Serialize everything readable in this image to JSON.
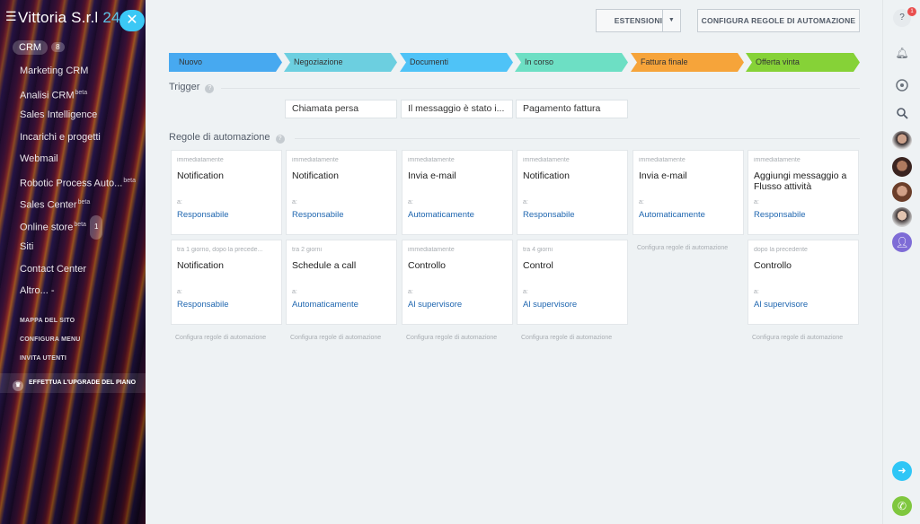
{
  "sidebar": {
    "company": "Vittoria S.r.l",
    "company_suffix": "24",
    "crm_label": "CRM",
    "crm_count": "8",
    "items": [
      {
        "label": "Marketing CRM",
        "beta": "",
        "count": ""
      },
      {
        "label": "Analisi CRM",
        "beta": "beta",
        "count": ""
      },
      {
        "label": "Sales Intelligence",
        "beta": "",
        "count": ""
      },
      {
        "label": "Incarichi e progetti",
        "beta": "",
        "count": ""
      },
      {
        "label": "Webmail",
        "beta": "",
        "count": ""
      },
      {
        "label": "Robotic Process Auto...",
        "beta": "beta",
        "count": ""
      },
      {
        "label": "Sales Center",
        "beta": "beta",
        "count": ""
      },
      {
        "label": "Online store",
        "beta": "beta",
        "count": "1"
      },
      {
        "label": "Siti",
        "beta": "",
        "count": ""
      },
      {
        "label": "Contact Center",
        "beta": "",
        "count": ""
      },
      {
        "label": "Altro... ",
        "beta": "",
        "count": "-"
      }
    ],
    "links": [
      "MAPPA DEL SITO",
      "CONFIGURA MENU",
      "INVITA UTENTI"
    ],
    "upgrade": "EFFETTUA L'UPGRADE DEL PIANO"
  },
  "toolbar": {
    "extensions_label": "ESTENSIONI",
    "config_label": "CONFIGURA REGOLE DI AUTOMAZIONE"
  },
  "stages": [
    {
      "label": "Nuovo",
      "color": "#47a9f0"
    },
    {
      "label": "Negoziazione",
      "color": "#6ccfe0"
    },
    {
      "label": "Documenti",
      "color": "#4fc3f7"
    },
    {
      "label": "In corso",
      "color": "#6ddfc4"
    },
    {
      "label": "Fattura finale",
      "color": "#f6a43a"
    },
    {
      "label": "Offerta vinta",
      "color": "#86d237"
    }
  ],
  "trigger": {
    "title": "Trigger",
    "items": [
      "Chiamata persa",
      "Il messaggio è stato i...",
      "Pagamento fattura"
    ]
  },
  "rules": {
    "title": "Regole di automazione",
    "a_label": "a:",
    "config_link": "Configura regole di automazione",
    "cards": [
      {
        "when": "immediatamente",
        "title": "Notification",
        "assign": "Responsabile"
      },
      {
        "when": "immediatamente",
        "title": "Notification",
        "assign": "Responsabile"
      },
      {
        "when": "immediatamente",
        "title": "Invia e-mail",
        "assign": "Automaticamente"
      },
      {
        "when": "immediatamente",
        "title": "Notification",
        "assign": "Responsabile"
      },
      {
        "when": "immediatamente",
        "title": "Invia e-mail",
        "assign": "Automaticamente"
      },
      {
        "when": "immediatamente",
        "title": "Aggiungi messaggio a Flusso attività",
        "assign": "Responsabile"
      },
      {
        "when": "tra 1 giorno, dopo la precede...",
        "title": "Notification",
        "assign": "Responsabile"
      },
      {
        "when": "tra 2 giorni",
        "title": "Schedule a call",
        "assign": "Automaticamente"
      },
      {
        "when": "immediatamente",
        "title": "Controllo",
        "assign": "Al supervisore"
      },
      {
        "when": "tra 4 giorni",
        "title": "Control",
        "assign": "Al supervisore"
      },
      {
        "when": "dopo la precedente",
        "title": "Controllo",
        "assign": "Al supervisore"
      }
    ]
  },
  "right_panel": {
    "help_badge": "1",
    "icons": [
      "help-icon",
      "bell-icon",
      "chat-icon",
      "search-icon",
      "add-user-icon",
      "open-channels-icon",
      "phone-icon"
    ]
  }
}
